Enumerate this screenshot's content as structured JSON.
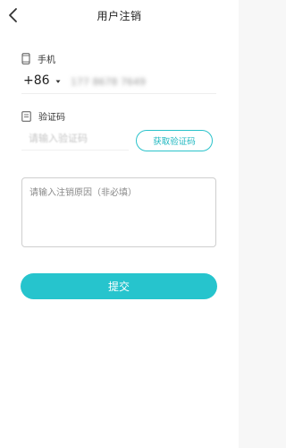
{
  "header": {
    "title": "用户注销",
    "back_icon": "chevron-left-icon"
  },
  "form": {
    "phone": {
      "label": "手机",
      "icon": "phone-icon",
      "country_code": "+86",
      "dropdown_icon": "caret-down-icon",
      "value": "177 8678 7649"
    },
    "code": {
      "label": "验证码",
      "icon": "document-icon",
      "placeholder": "请输入验证码",
      "get_code_label": "获取验证码"
    },
    "reason": {
      "placeholder": "请输入注销原因（非必填）"
    },
    "submit_label": "提交"
  },
  "colors": {
    "accent": "#26c4cd",
    "background": "#f7f7f7",
    "text": "#333333"
  }
}
